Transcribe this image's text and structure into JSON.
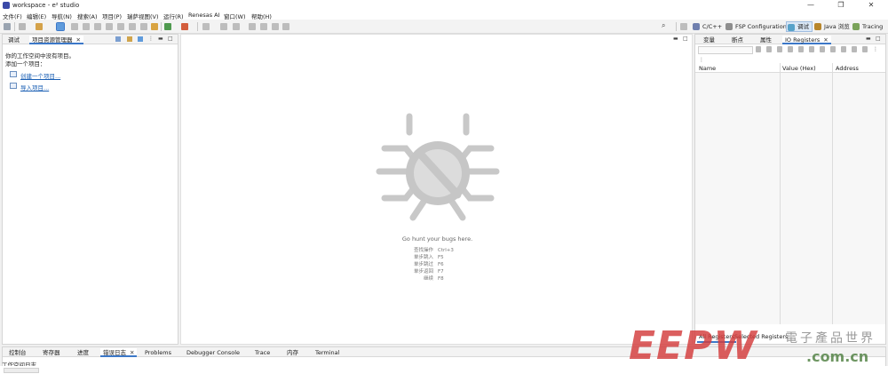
{
  "window": {
    "title": "workspace - e² studio",
    "minimize": "—",
    "maximize": "❐",
    "close": "✕"
  },
  "menu": [
    "文件(F)",
    "编辑(E)",
    "导航(N)",
    "搜索(A)",
    "项目(P)",
    "瑞萨视图(V)",
    "运行(R)",
    "Renesas AI",
    "窗口(W)",
    "帮助(H)"
  ],
  "perspectives": [
    "C/C++",
    "FSP Configuration",
    "调试",
    "Java 浏览",
    "Tracing"
  ],
  "colors": {
    "accent": "#3c78c8",
    "bug": "#c6c6c6",
    "link": "#1a5fb4",
    "watermark_red": "#d43c3c"
  },
  "left_panel": {
    "tabs": [
      "调试",
      "项目资源管理器"
    ],
    "line1": "你的工作空间中没有项目。",
    "line2": "添加一个项目：",
    "link1": "创建一个项目...",
    "link2": "导入项目..."
  },
  "center": {
    "headline": "Go hunt your bugs here.",
    "shortcuts": [
      {
        "label": "查找操作",
        "key": "Ctrl+3"
      },
      {
        "label": "单步跳入",
        "key": "F5"
      },
      {
        "label": "单步跳过",
        "key": "F6"
      },
      {
        "label": "单步返回",
        "key": "F7"
      },
      {
        "label": "继续",
        "key": "F8"
      }
    ]
  },
  "right_panel": {
    "tabs": [
      "变量",
      "断点",
      "属性",
      "IO Registers"
    ],
    "columns": [
      "Name",
      "Value (Hex)",
      "Address"
    ],
    "bottom_tabs": [
      "All Registers",
      "Selected Registers"
    ]
  },
  "bottom_panel": {
    "tabs": [
      "控制台",
      "寄存器",
      "进度",
      "错误日志",
      "Problems",
      "Debugger Console",
      "Trace",
      "内存",
      "Terminal"
    ],
    "content": "工作空间日志"
  },
  "watermark": {
    "logo": "EEPW",
    "title": "電子產品世界",
    "url": ".com.cn"
  }
}
